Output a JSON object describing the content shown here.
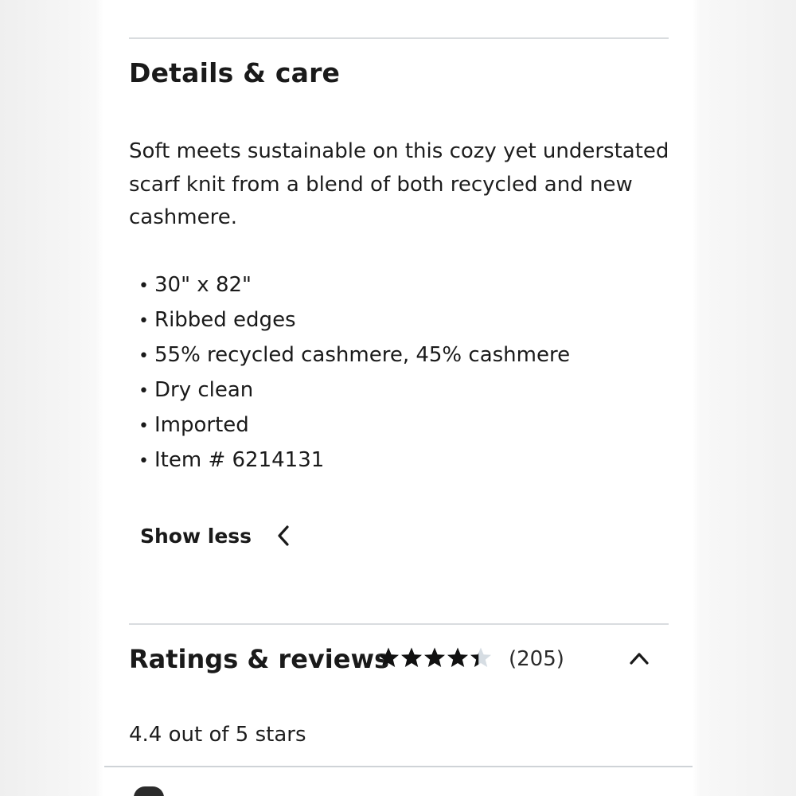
{
  "details": {
    "title": "Details & care",
    "description": "Soft meets sustainable on this cozy yet understated scarf knit from a blend of both recycled and new cashmere.",
    "bullets": [
      "30\" x 82\"",
      "Ribbed edges",
      "55% recycled cashmere, 45% cashmere",
      "Dry clean",
      "Imported",
      "Item # 6214131"
    ],
    "toggle_label": "Show less",
    "toggle_icon": "chevron-left-icon"
  },
  "ratings": {
    "title": "Ratings & reviews",
    "rating_value": 4.4,
    "rating_max": 5,
    "review_count": "(205)",
    "summary": "4.4 out of 5 stars",
    "toggle_icon": "chevron-up-icon",
    "star_color": "#111111",
    "star_empty_color": "#d6dde3"
  }
}
